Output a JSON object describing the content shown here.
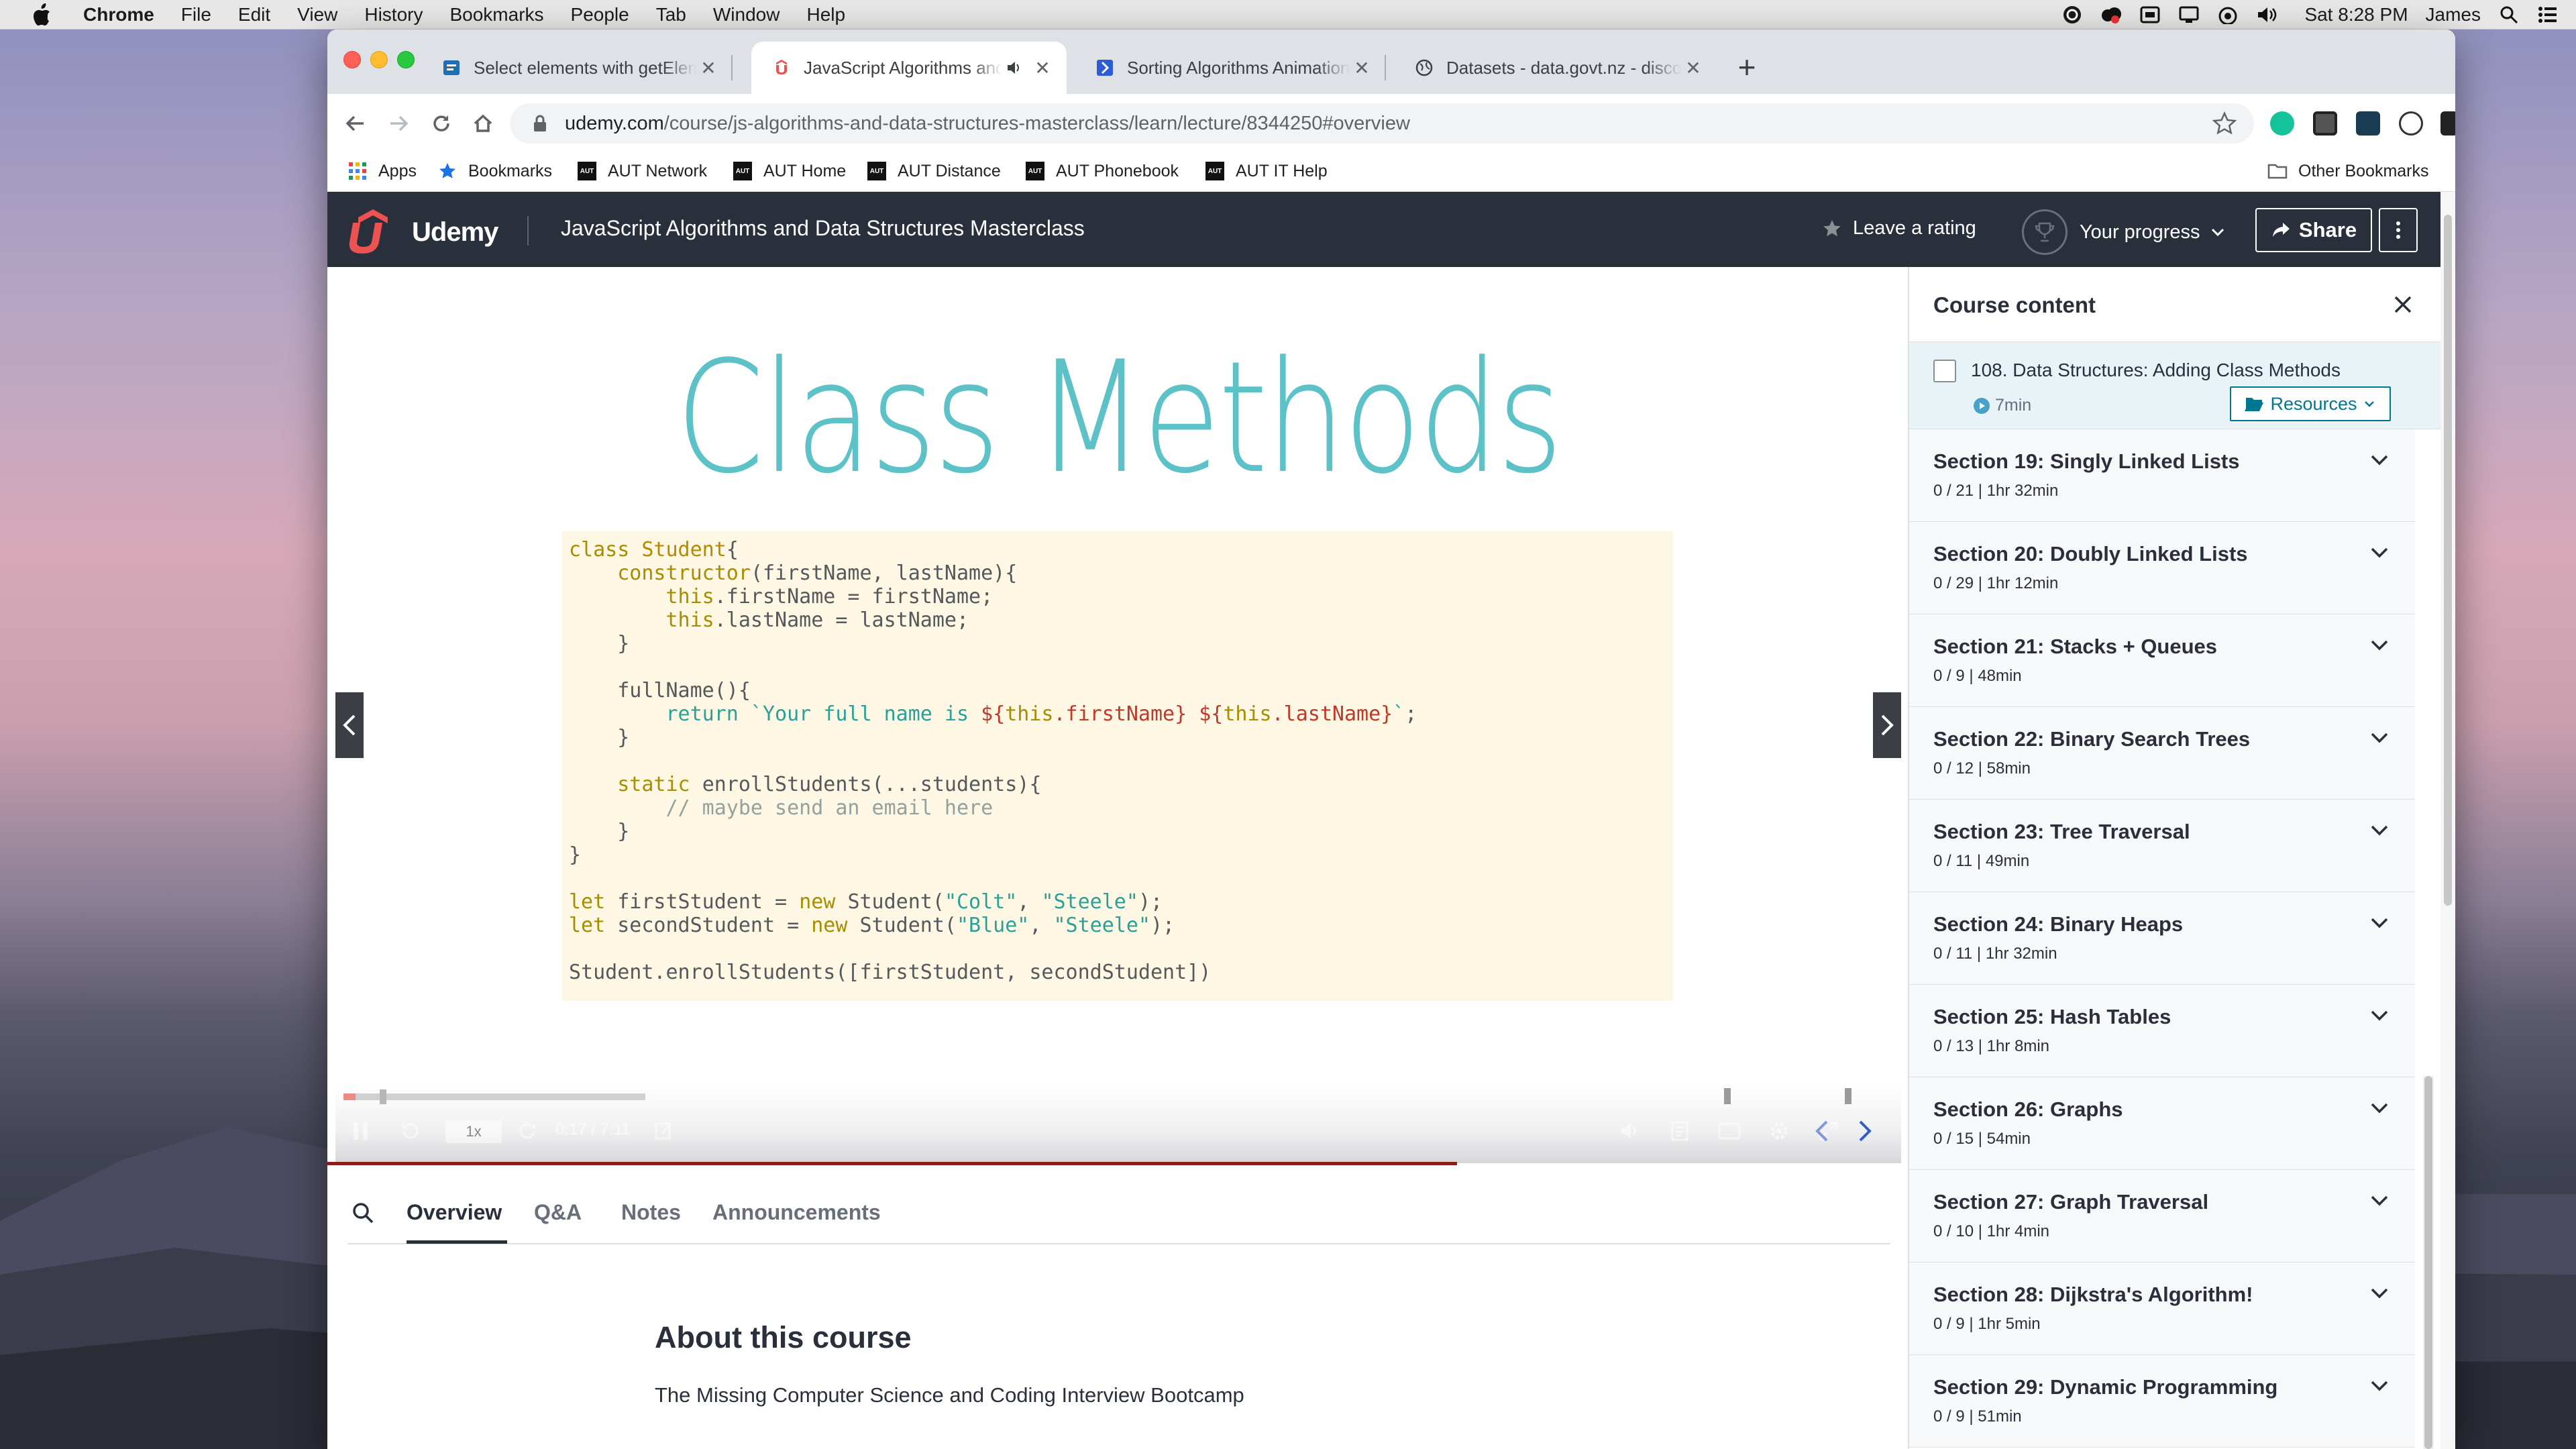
{
  "menubar": {
    "app": "Chrome",
    "items": [
      "File",
      "Edit",
      "View",
      "History",
      "Bookmarks",
      "People",
      "Tab",
      "Window",
      "Help"
    ],
    "clock": "Sat 8:28 PM",
    "user": "James"
  },
  "tabs": [
    {
      "title": "Select elements with getElementsByClassName",
      "favicon": "page-icon"
    },
    {
      "title": "JavaScript Algorithms and Data Structures Masterclass",
      "favicon": "udemy-icon",
      "audio": true
    },
    {
      "title": "Sorting Algorithms Animations",
      "favicon": "toptal-icon"
    },
    {
      "title": "Datasets - data.govt.nz - discover and use data",
      "favicon": "globe-icon"
    }
  ],
  "address": {
    "domain": "udemy.com",
    "path": "/course/js-algorithms-and-data-structures-masterclass/learn/lecture/8344250#overview"
  },
  "bookmarks": {
    "apps": "Apps",
    "items": [
      "Bookmarks",
      "AUT Network",
      "AUT Home",
      "AUT Distance",
      "AUT Phonebook",
      "AUT IT Help"
    ],
    "aut_badge": "AUT",
    "other": "Other Bookmarks"
  },
  "udemy": {
    "logo": "Udemy",
    "course_title": "JavaScript Algorithms and Data Structures Masterclass",
    "leave_rating": "Leave a rating",
    "your_progress": "Your progress",
    "share": "Share",
    "brand_color": "#ec5252"
  },
  "video": {
    "slide_title": "Class Methods",
    "speed": "1x",
    "time": "0:17 / 7:11",
    "progress": 0.04,
    "buffered": 0.12,
    "code_lines": [
      [
        [
          "kw",
          "class "
        ],
        [
          "vr",
          "Student"
        ],
        [
          "",
          "{"
        ]
      ],
      [
        [
          "",
          "    "
        ],
        [
          "kw",
          "constructor"
        ],
        [
          "",
          "(firstName, lastName){"
        ]
      ],
      [
        [
          "",
          "        "
        ],
        [
          "kw",
          "this"
        ],
        [
          "",
          ".firstName = firstName;"
        ]
      ],
      [
        [
          "",
          "        "
        ],
        [
          "kw",
          "this"
        ],
        [
          "",
          ".lastName = lastName;"
        ]
      ],
      [
        [
          "",
          "    }"
        ]
      ],
      [
        [
          "",
          ""
        ]
      ],
      [
        [
          "",
          "    fullName(){"
        ]
      ],
      [
        [
          "",
          "        "
        ],
        [
          "str",
          "return `Your full name is "
        ],
        [
          "rd",
          "${"
        ],
        [
          "kw",
          "this"
        ],
        [
          "rd",
          ".firstName}"
        ],
        [
          "str",
          " "
        ],
        [
          "rd",
          "${"
        ],
        [
          "kw",
          "this"
        ],
        [
          "rd",
          ".lastName}"
        ],
        [
          "str",
          "`"
        ],
        [
          "",
          ";"
        ]
      ],
      [
        [
          "",
          "    }"
        ]
      ],
      [
        [
          "",
          ""
        ]
      ],
      [
        [
          "",
          "    "
        ],
        [
          "kw",
          "static "
        ],
        [
          "",
          "enrollStudents(...students){"
        ]
      ],
      [
        [
          "",
          "        "
        ],
        [
          "cm",
          "// maybe send an email here"
        ]
      ],
      [
        [
          "",
          "    }"
        ]
      ],
      [
        [
          "",
          "}"
        ]
      ],
      [
        [
          "",
          ""
        ]
      ],
      [
        [
          "kw",
          "let "
        ],
        [
          "",
          "firstStudent = "
        ],
        [
          "kw",
          "new "
        ],
        [
          "",
          "Student("
        ],
        [
          "str",
          "\"Colt\""
        ],
        [
          "",
          ", "
        ],
        [
          "str",
          "\"Steele\""
        ],
        [
          "",
          ");"
        ]
      ],
      [
        [
          "kw",
          "let "
        ],
        [
          "",
          "secondStudent = "
        ],
        [
          "kw",
          "new "
        ],
        [
          "",
          "Student("
        ],
        [
          "str",
          "\"Blue\""
        ],
        [
          "",
          ", "
        ],
        [
          "str",
          "\"Steele\""
        ],
        [
          "",
          ");"
        ]
      ],
      [
        [
          "",
          ""
        ]
      ],
      [
        [
          "",
          "Student.enrollStudents([firstStudent, secondStudent])"
        ]
      ]
    ]
  },
  "lower_tabs": [
    "Overview",
    "Q&A",
    "Notes",
    "Announcements"
  ],
  "about": {
    "heading": "About this course",
    "text": "The Missing Computer Science and Coding Interview Bootcamp"
  },
  "sidebar": {
    "title": "Course content",
    "lecture": {
      "title": "108. Data Structures: Adding Class Methods",
      "duration": "7min",
      "resources": "Resources"
    },
    "sections": [
      {
        "title": "Section 19: Singly Linked Lists",
        "meta": "0 / 21 | 1hr 32min"
      },
      {
        "title": "Section 20: Doubly Linked Lists",
        "meta": "0 / 29 | 1hr 12min"
      },
      {
        "title": "Section 21: Stacks + Queues",
        "meta": "0 / 9 | 48min"
      },
      {
        "title": "Section 22: Binary Search Trees",
        "meta": "0 / 12 | 58min"
      },
      {
        "title": "Section 23: Tree Traversal",
        "meta": "0 / 11 | 49min"
      },
      {
        "title": "Section 24: Binary Heaps",
        "meta": "0 / 11 | 1hr 32min"
      },
      {
        "title": "Section 25: Hash Tables",
        "meta": "0 / 13 | 1hr 8min"
      },
      {
        "title": "Section 26: Graphs",
        "meta": "0 / 15 | 54min"
      },
      {
        "title": "Section 27: Graph Traversal",
        "meta": "0 / 10 | 1hr 4min"
      },
      {
        "title": "Section 28: Dijkstra's Algorithm!",
        "meta": "0 / 9 | 1hr 5min"
      },
      {
        "title": "Section 29: Dynamic Programming",
        "meta": "0 / 9 | 51min"
      }
    ]
  }
}
